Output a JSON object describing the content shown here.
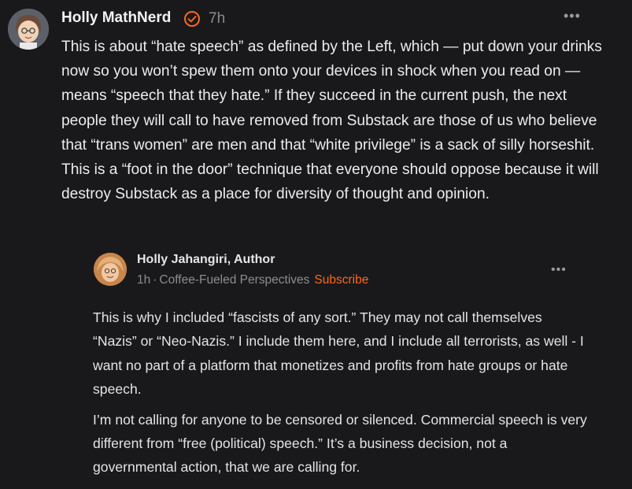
{
  "post": {
    "author": "Holly MathNerd",
    "time": "7h",
    "text": "This is about “hate speech” as defined by the Left, which — put down your drinks now so you won’t spew them onto your devices in shock when you read on — means “speech that they hate.” If they succeed in the current push, the next people they will call to have removed from Substack are those of us who believe that “trans women” are men and that “white privilege” is a sack of silly horseshit. This is a “foot in the door” technique that everyone should oppose because it will destroy Substack as a place for diversity of thought and opinion.",
    "menu_icon": "more-horizontal-icon",
    "verified_icon": "verified-check-icon"
  },
  "reply": {
    "author": "Holly Jahangiri, Author",
    "time": "1h",
    "separator": "·",
    "publication": "Coffee-Fueled Perspectives",
    "subscribe_label": "Subscribe",
    "paragraph1": "This is why I included “fascists of any sort.” They may not call themselves “Nazis” or “Neo-Nazis.” I include them here, and I include all terrorists, as well - I want no part of a platform that monetizes and profits from hate groups or hate speech.",
    "paragraph2": "I’m not calling for anyone to be censored or silenced. Commercial speech is very different from “free (political) speech.” It’s a business decision, not a governmental action, that we are calling for.",
    "menu_icon": "more-horizontal-icon"
  },
  "colors": {
    "background": "#19191b",
    "subscribe_accent": "#ff6719",
    "verified_accent": "#ff6719"
  }
}
